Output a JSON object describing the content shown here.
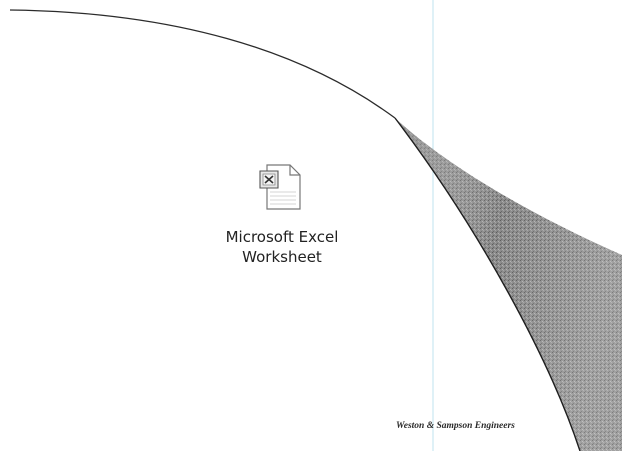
{
  "desktop_item": {
    "icon": "excel-document-icon",
    "label_line1": "Microsoft Excel",
    "label_line2": "Worksheet"
  },
  "footer": {
    "credit": "Weston & Sampson Engineers"
  }
}
